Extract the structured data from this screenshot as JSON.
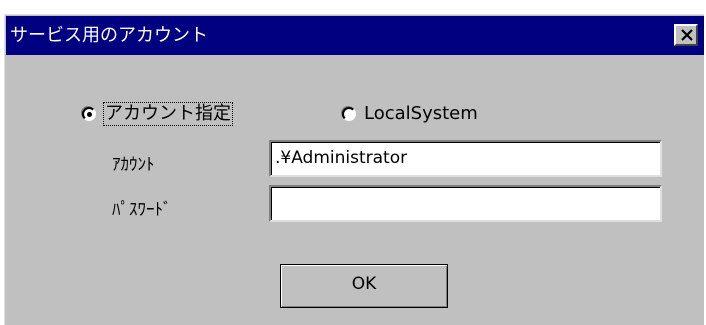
{
  "window": {
    "title": "サービス用のアカウント",
    "close_icon": "close-icon"
  },
  "account_mode": {
    "specified_label": "アカウント指定",
    "specified_selected": true,
    "local_system_label": "LocalSystem",
    "local_system_selected": false
  },
  "fields": {
    "account_label": "ｱｶｳﾝﾄ",
    "account_value": ".¥Administrator",
    "password_label": "ﾊﾟｽﾜｰﾄﾞ",
    "password_value": ""
  },
  "buttons": {
    "ok_label": "OK"
  },
  "colors": {
    "titlebar": "#000080",
    "face": "#c0c0c0"
  }
}
